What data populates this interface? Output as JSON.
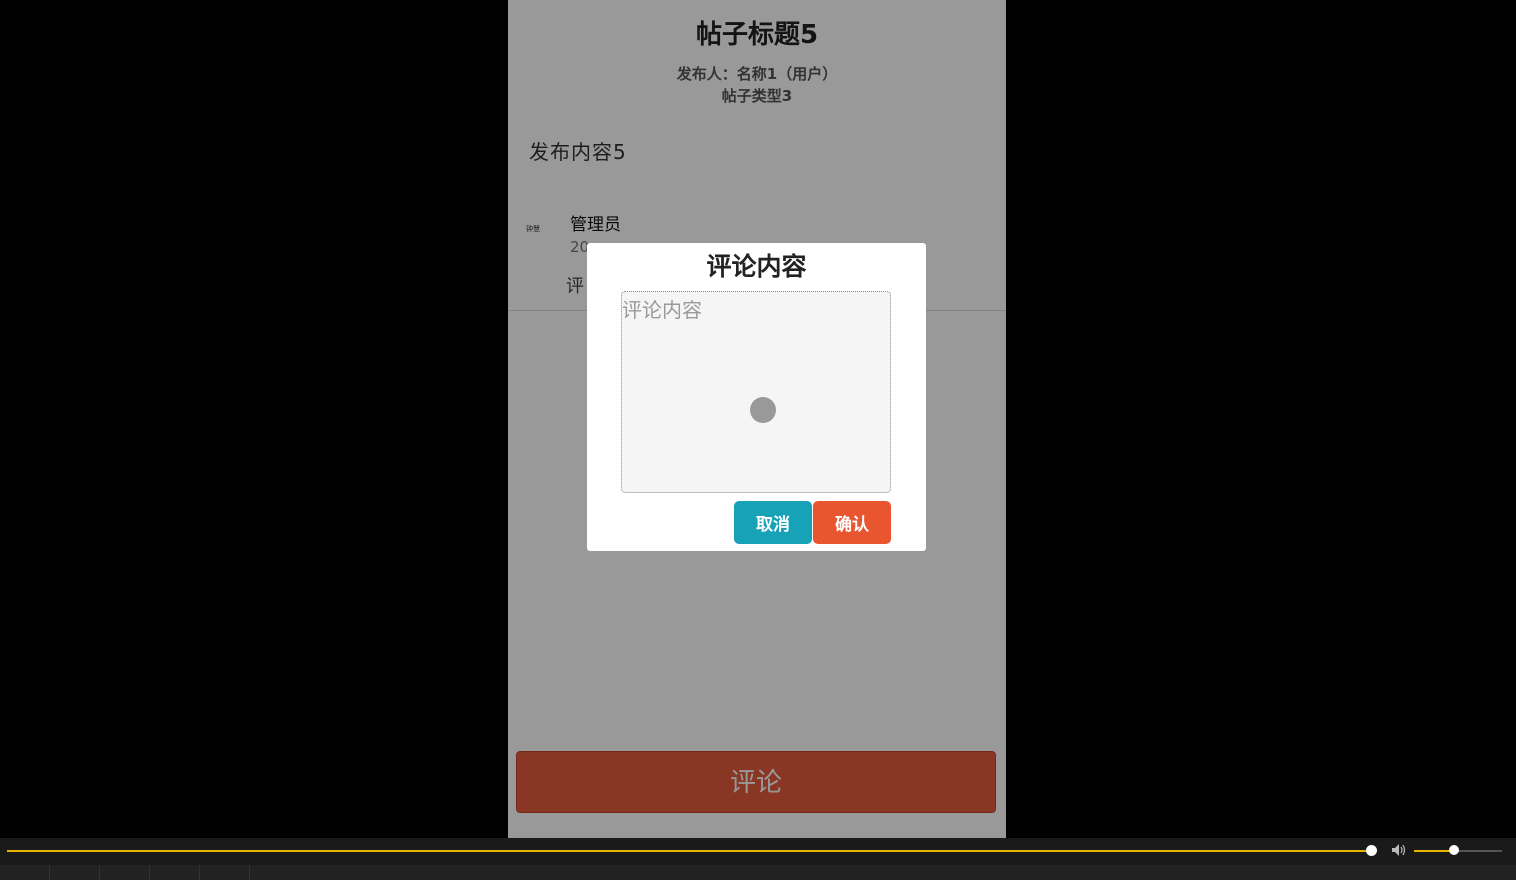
{
  "post": {
    "title": "帖子标题5",
    "author_line": "发布人：名称1（用户）",
    "type_line": "帖子类型3",
    "content": "发布内容5"
  },
  "comment": {
    "avatar_text": "钟慧",
    "user_name": "管理员",
    "time_partial": "20",
    "text_partial": "评"
  },
  "bottom_button": {
    "label": "评论"
  },
  "modal": {
    "title": "评论内容",
    "textarea_placeholder": "评论内容",
    "cancel_label": "取消",
    "confirm_label": "确认"
  },
  "player": {
    "progress": 1.0,
    "volume": 0.45,
    "volume_icon": "volume-icon"
  },
  "colors": {
    "cancel": "#17a2b8",
    "confirm": "#e8552f",
    "comment_button": "#e45a3f",
    "progress": "#e8b400"
  }
}
